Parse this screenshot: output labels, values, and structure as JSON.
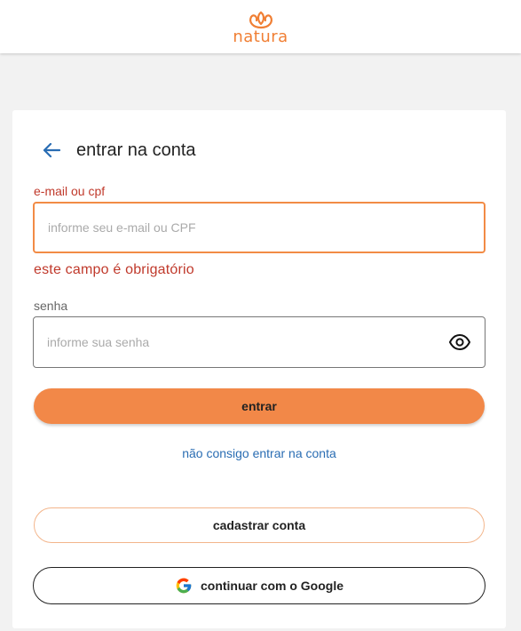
{
  "header": {
    "brand_name": "natura",
    "logo_icon": "natura-flower-logo",
    "brand_color": "#f07f34"
  },
  "login": {
    "back_icon": "arrow-left-icon",
    "title": "entrar na conta",
    "email": {
      "label": "e-mail ou cpf",
      "placeholder": "informe seu e-mail ou CPF",
      "value": "",
      "error": "este campo é obrigatório"
    },
    "password": {
      "label": "senha",
      "placeholder": "informe sua senha",
      "value": "",
      "toggle_icon": "eye-icon"
    },
    "submit_label": "entrar",
    "forgot_link": "não consigo entrar na conta",
    "register_label": "cadastrar conta",
    "google_label": "continuar com o Google",
    "google_icon": "google-icon"
  },
  "colors": {
    "accent": "#f28848",
    "error": "#c0392b",
    "link": "#2a6db3"
  }
}
